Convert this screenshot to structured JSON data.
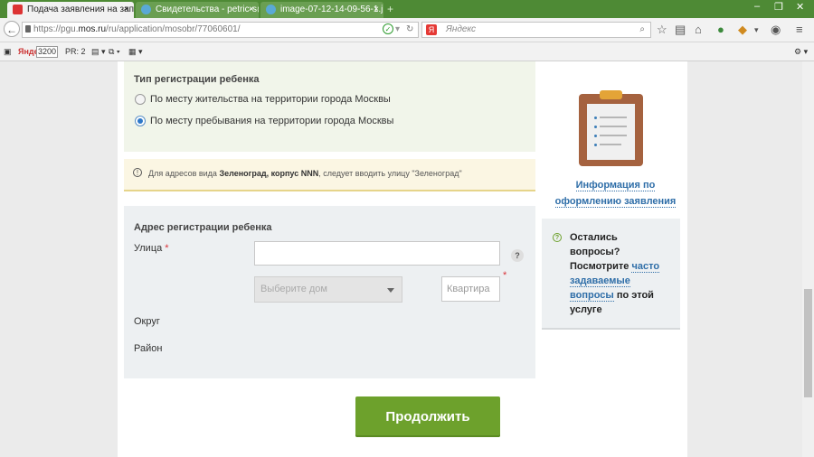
{
  "browser": {
    "tabs": [
      {
        "title": "Подача заявления на зап..."
      },
      {
        "title": "Свидетельства - petric-s@..."
      },
      {
        "title": "image-07-12-14-09-56-1.jp..."
      }
    ],
    "url_prefix": "https://pgu.",
    "url_domain": "mos.ru",
    "url_path": "/ru/application/mosobr/77060601/",
    "search_placeholder": "Яндекс",
    "bookmarks": {
      "yandex_label": "Яндекс",
      "yandex_value": "3200",
      "pr_label": "PR: 2"
    }
  },
  "form": {
    "registration_type": {
      "heading": "Тип регистрации ребенка",
      "options": [
        {
          "label": "По месту жительства на территории города Москвы",
          "selected": false
        },
        {
          "label": "По месту пребывания на территории города Москвы",
          "selected": true
        }
      ]
    },
    "notice": {
      "prefix": "Для адресов вида ",
      "bold": "Зеленоград, корпус NNN",
      "suffix": ", следует вводить улицу \"Зеленоград\""
    },
    "address": {
      "heading": "Адрес регистрации ребенка",
      "street_label": "Улица",
      "required_mark": "*",
      "street_value": "",
      "help": "?",
      "house_placeholder": "Выберите дом",
      "apartment_placeholder": "Квартира",
      "district_label": "Округ",
      "area_label": "Район"
    },
    "continue_label": "Продолжить"
  },
  "sidebar": {
    "info_link_line1": "Информация по",
    "info_link_line2": "оформлению заявления",
    "faq": {
      "line1": "Остались",
      "line2": "вопросы?",
      "line3_prefix": "Посмотрите ",
      "link1": "часто",
      "link2": "задаваемые",
      "link3": "вопросы",
      "line_suffix": " по этой",
      "line_end": "услуге"
    }
  }
}
